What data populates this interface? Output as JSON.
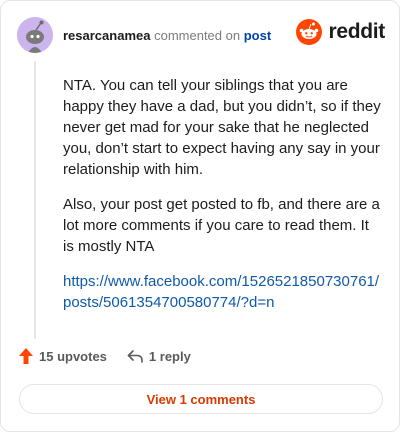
{
  "comment": {
    "username": "resarcanamea",
    "action_text": "commented on",
    "target_link": "post",
    "paragraphs": [
      "NTA. You can tell your siblings that you are happy they have a dad, but you didn’t, so if they never get mad for your sake that he neglected you, don’t start to expect having any say in your relationship with him.",
      "Also, your post get posted to fb, and there are a lot more comments if you care to read them. It is mostly NTA"
    ],
    "link_text": "https://www.facebook.com/1526521850730761/posts/5061354700580774/?d=n"
  },
  "brand": {
    "name": "reddit",
    "accent_color": "#ff4500"
  },
  "footer": {
    "upvotes_label": "15 upvotes",
    "reply_label": "1 reply",
    "view_comments_label": "View 1 comments"
  },
  "icons": {
    "avatar": "snoo-avatar-icon",
    "logo": "reddit-logo-icon",
    "upvote": "upvote-arrow-icon",
    "reply": "reply-arrow-icon"
  },
  "colors": {
    "avatar_bg": "#ccb5ee",
    "upvote": "#ff4500",
    "link": "#0f5aa8",
    "view_button_text": "#d93a00"
  }
}
